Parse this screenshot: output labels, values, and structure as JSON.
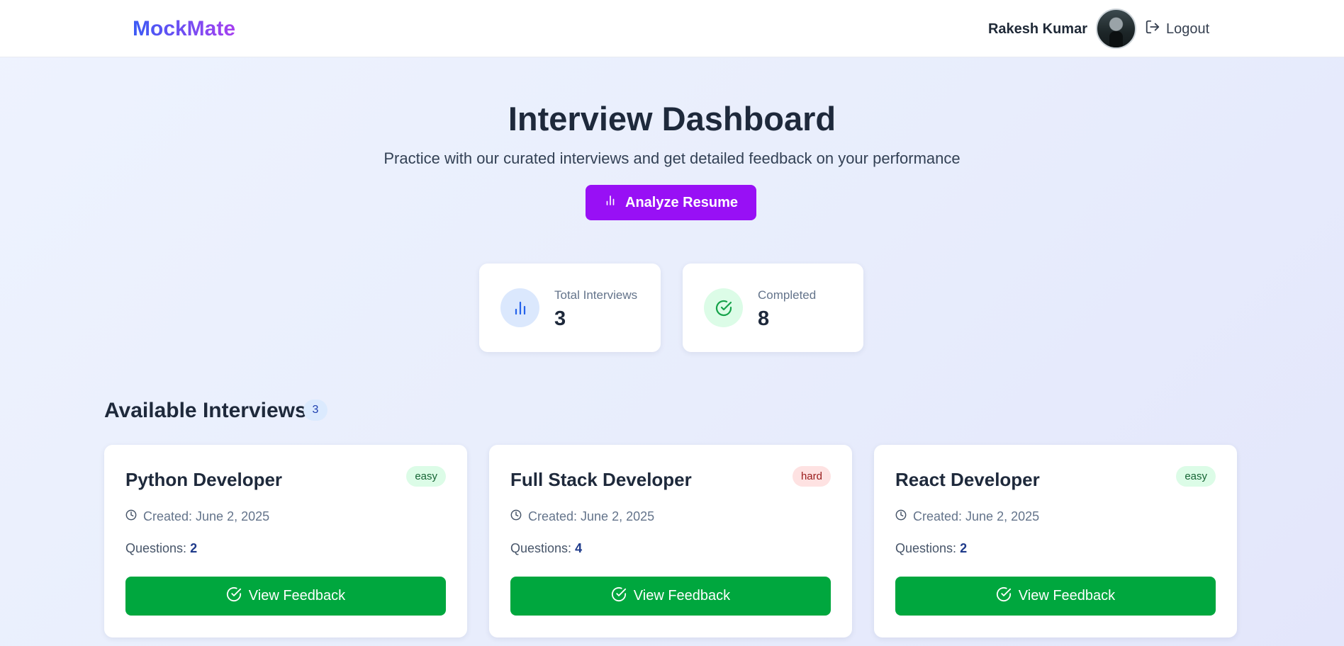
{
  "navbar": {
    "logo": "MockMate",
    "user_name": "Rakesh Kumar",
    "logout_label": "Logout"
  },
  "hero": {
    "title": "Interview Dashboard",
    "subtitle": "Practice with our curated interviews and get detailed feedback on your performance",
    "analyze_button": "Analyze Resume"
  },
  "stats": [
    {
      "label": "Total Interviews",
      "value": "3",
      "icon": "bar-chart-icon",
      "color": "#2563eb"
    },
    {
      "label": "Completed",
      "value": "8",
      "icon": "check-circle-icon",
      "color": "#16a34a"
    }
  ],
  "section": {
    "title": "Available Interviews",
    "count": "3"
  },
  "interviews": [
    {
      "title": "Python Developer",
      "difficulty": "easy",
      "created": "Created: June 2, 2025",
      "questions_label": "Questions:",
      "questions": "2",
      "button": "View Feedback"
    },
    {
      "title": "Full Stack Developer",
      "difficulty": "hard",
      "created": "Created: June 2, 2025",
      "questions_label": "Questions:",
      "questions": "4",
      "button": "View Feedback"
    },
    {
      "title": "React Developer",
      "difficulty": "easy",
      "created": "Created: June 2, 2025",
      "questions_label": "Questions:",
      "questions": "2",
      "button": "View Feedback"
    }
  ],
  "colors": {
    "primary_purple": "#9810f5",
    "success_green": "#00a73e",
    "brand_gradient_start": "#3b5bf5",
    "brand_gradient_end": "#a640f0"
  }
}
